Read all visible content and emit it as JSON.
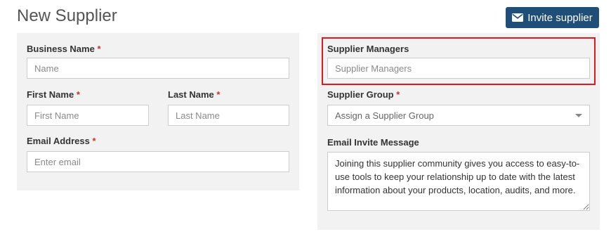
{
  "page": {
    "title": "New Supplier"
  },
  "header": {
    "invite_button_label": "Invite supplier",
    "invite_button_icon": "envelope-icon",
    "invite_button_color": "#1f4e79"
  },
  "left_panel": {
    "business_name": {
      "label": "Business Name",
      "required_mark": "*",
      "placeholder": "Name",
      "value": ""
    },
    "first_name": {
      "label": "First Name",
      "required_mark": "*",
      "placeholder": "First Name",
      "value": ""
    },
    "last_name": {
      "label": "Last Name",
      "required_mark": "*",
      "placeholder": "Last Name",
      "value": ""
    },
    "email_address": {
      "label": "Email Address",
      "required_mark": "*",
      "placeholder": "Enter email",
      "value": ""
    }
  },
  "right_panel": {
    "supplier_managers": {
      "label": "Supplier Managers",
      "placeholder": "Supplier Managers",
      "value": "",
      "highlight_color": "#e0191f"
    },
    "supplier_group": {
      "label": "Supplier Group",
      "required_mark": "*",
      "selected": "Assign a Supplier Group"
    },
    "email_invite_message": {
      "label": "Email Invite Message",
      "value": "Joining this supplier community gives you access to easy-to-use tools to keep your relationship up to date with the latest information about your products, location, audits, and more."
    }
  },
  "colors": {
    "required": "#c0392b",
    "panel_background": "#f2f2f2"
  }
}
